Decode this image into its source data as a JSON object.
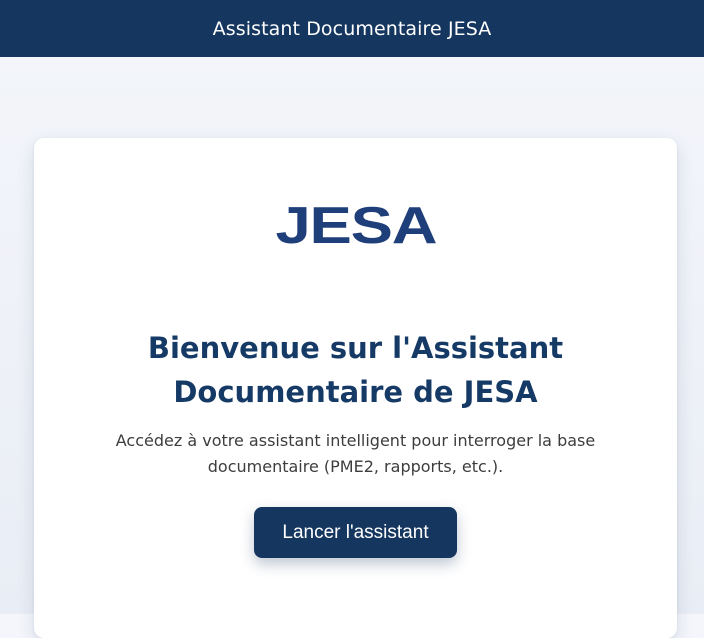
{
  "header": {
    "title": "Assistant Documentaire JESA"
  },
  "card": {
    "logo_text": "JESA",
    "headline": "Bienvenue sur l'Assistant Documentaire de JESA",
    "subtitle": "Accédez à votre assistant intelligent pour interroger la base documentaire (PME2, rapports, etc.).",
    "cta_label": "Lancer l'assistant"
  },
  "colors": {
    "header_bg": "#14365f",
    "headline": "#163a66",
    "logo": "#1f3f7a",
    "button_bg": "#14365f"
  }
}
